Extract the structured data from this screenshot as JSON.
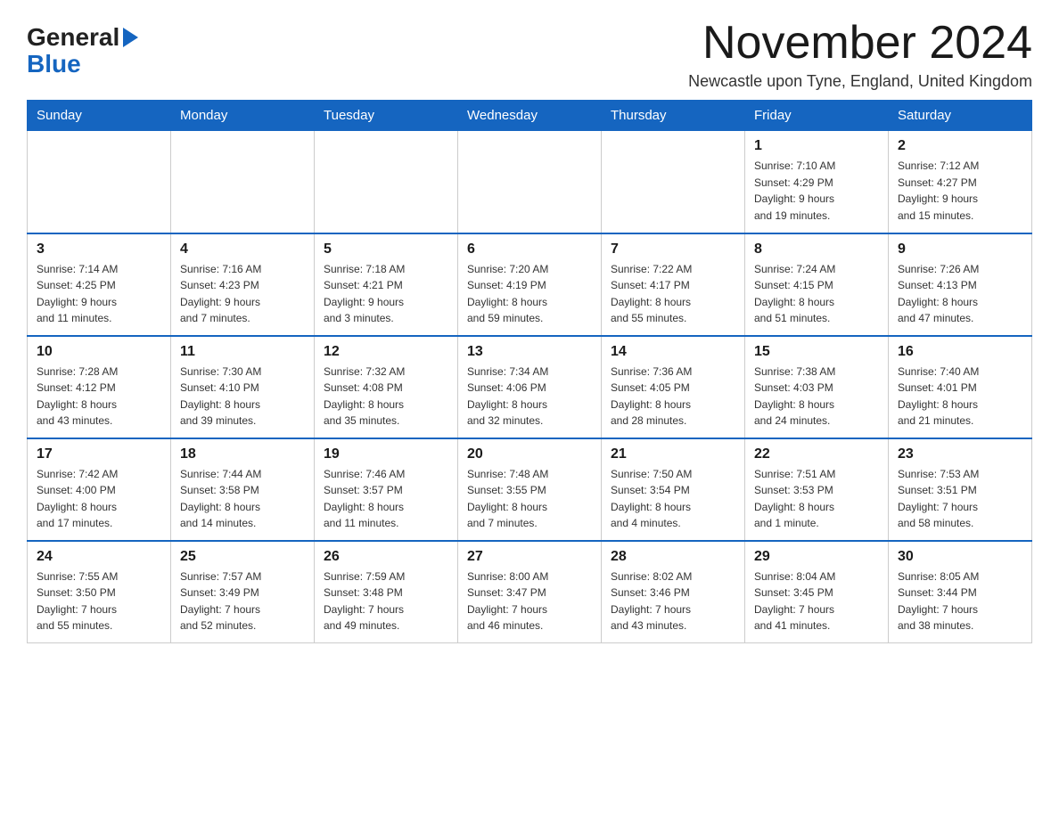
{
  "header": {
    "logo_general": "General",
    "logo_blue": "Blue",
    "month_title": "November 2024",
    "location": "Newcastle upon Tyne, England, United Kingdom"
  },
  "calendar": {
    "days_of_week": [
      "Sunday",
      "Monday",
      "Tuesday",
      "Wednesday",
      "Thursday",
      "Friday",
      "Saturday"
    ],
    "weeks": [
      [
        {
          "day": "",
          "info": ""
        },
        {
          "day": "",
          "info": ""
        },
        {
          "day": "",
          "info": ""
        },
        {
          "day": "",
          "info": ""
        },
        {
          "day": "",
          "info": ""
        },
        {
          "day": "1",
          "info": "Sunrise: 7:10 AM\nSunset: 4:29 PM\nDaylight: 9 hours\nand 19 minutes."
        },
        {
          "day": "2",
          "info": "Sunrise: 7:12 AM\nSunset: 4:27 PM\nDaylight: 9 hours\nand 15 minutes."
        }
      ],
      [
        {
          "day": "3",
          "info": "Sunrise: 7:14 AM\nSunset: 4:25 PM\nDaylight: 9 hours\nand 11 minutes."
        },
        {
          "day": "4",
          "info": "Sunrise: 7:16 AM\nSunset: 4:23 PM\nDaylight: 9 hours\nand 7 minutes."
        },
        {
          "day": "5",
          "info": "Sunrise: 7:18 AM\nSunset: 4:21 PM\nDaylight: 9 hours\nand 3 minutes."
        },
        {
          "day": "6",
          "info": "Sunrise: 7:20 AM\nSunset: 4:19 PM\nDaylight: 8 hours\nand 59 minutes."
        },
        {
          "day": "7",
          "info": "Sunrise: 7:22 AM\nSunset: 4:17 PM\nDaylight: 8 hours\nand 55 minutes."
        },
        {
          "day": "8",
          "info": "Sunrise: 7:24 AM\nSunset: 4:15 PM\nDaylight: 8 hours\nand 51 minutes."
        },
        {
          "day": "9",
          "info": "Sunrise: 7:26 AM\nSunset: 4:13 PM\nDaylight: 8 hours\nand 47 minutes."
        }
      ],
      [
        {
          "day": "10",
          "info": "Sunrise: 7:28 AM\nSunset: 4:12 PM\nDaylight: 8 hours\nand 43 minutes."
        },
        {
          "day": "11",
          "info": "Sunrise: 7:30 AM\nSunset: 4:10 PM\nDaylight: 8 hours\nand 39 minutes."
        },
        {
          "day": "12",
          "info": "Sunrise: 7:32 AM\nSunset: 4:08 PM\nDaylight: 8 hours\nand 35 minutes."
        },
        {
          "day": "13",
          "info": "Sunrise: 7:34 AM\nSunset: 4:06 PM\nDaylight: 8 hours\nand 32 minutes."
        },
        {
          "day": "14",
          "info": "Sunrise: 7:36 AM\nSunset: 4:05 PM\nDaylight: 8 hours\nand 28 minutes."
        },
        {
          "day": "15",
          "info": "Sunrise: 7:38 AM\nSunset: 4:03 PM\nDaylight: 8 hours\nand 24 minutes."
        },
        {
          "day": "16",
          "info": "Sunrise: 7:40 AM\nSunset: 4:01 PM\nDaylight: 8 hours\nand 21 minutes."
        }
      ],
      [
        {
          "day": "17",
          "info": "Sunrise: 7:42 AM\nSunset: 4:00 PM\nDaylight: 8 hours\nand 17 minutes."
        },
        {
          "day": "18",
          "info": "Sunrise: 7:44 AM\nSunset: 3:58 PM\nDaylight: 8 hours\nand 14 minutes."
        },
        {
          "day": "19",
          "info": "Sunrise: 7:46 AM\nSunset: 3:57 PM\nDaylight: 8 hours\nand 11 minutes."
        },
        {
          "day": "20",
          "info": "Sunrise: 7:48 AM\nSunset: 3:55 PM\nDaylight: 8 hours\nand 7 minutes."
        },
        {
          "day": "21",
          "info": "Sunrise: 7:50 AM\nSunset: 3:54 PM\nDaylight: 8 hours\nand 4 minutes."
        },
        {
          "day": "22",
          "info": "Sunrise: 7:51 AM\nSunset: 3:53 PM\nDaylight: 8 hours\nand 1 minute."
        },
        {
          "day": "23",
          "info": "Sunrise: 7:53 AM\nSunset: 3:51 PM\nDaylight: 7 hours\nand 58 minutes."
        }
      ],
      [
        {
          "day": "24",
          "info": "Sunrise: 7:55 AM\nSunset: 3:50 PM\nDaylight: 7 hours\nand 55 minutes."
        },
        {
          "day": "25",
          "info": "Sunrise: 7:57 AM\nSunset: 3:49 PM\nDaylight: 7 hours\nand 52 minutes."
        },
        {
          "day": "26",
          "info": "Sunrise: 7:59 AM\nSunset: 3:48 PM\nDaylight: 7 hours\nand 49 minutes."
        },
        {
          "day": "27",
          "info": "Sunrise: 8:00 AM\nSunset: 3:47 PM\nDaylight: 7 hours\nand 46 minutes."
        },
        {
          "day": "28",
          "info": "Sunrise: 8:02 AM\nSunset: 3:46 PM\nDaylight: 7 hours\nand 43 minutes."
        },
        {
          "day": "29",
          "info": "Sunrise: 8:04 AM\nSunset: 3:45 PM\nDaylight: 7 hours\nand 41 minutes."
        },
        {
          "day": "30",
          "info": "Sunrise: 8:05 AM\nSunset: 3:44 PM\nDaylight: 7 hours\nand 38 minutes."
        }
      ]
    ]
  }
}
